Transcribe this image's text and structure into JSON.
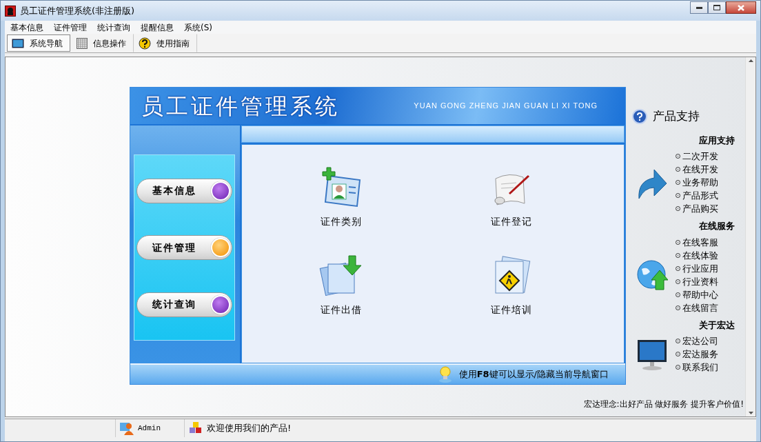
{
  "window": {
    "title": "员工证件管理系统(非注册版)"
  },
  "menu": [
    {
      "label": "基本信息"
    },
    {
      "label": "证件管理"
    },
    {
      "label": "统计查询"
    },
    {
      "label": "提醒信息"
    },
    {
      "label": "系统(S)"
    }
  ],
  "toolbar": [
    {
      "label": "系统导航",
      "selected": true,
      "kind": "window"
    },
    {
      "label": "信息操作",
      "selected": false,
      "kind": "grid"
    },
    {
      "label": "使用指南",
      "selected": false,
      "kind": "help"
    }
  ],
  "banner": {
    "title": "员工证件管理系统",
    "subtitle": "YUAN GONG ZHENG JIAN GUAN LI XI TONG"
  },
  "nav_buttons": [
    {
      "label": "基本信息",
      "selected": false
    },
    {
      "label": "证件管理",
      "selected": true
    },
    {
      "label": "统计查询",
      "selected": false
    }
  ],
  "tiles": [
    {
      "label": "证件类别",
      "kind": "card"
    },
    {
      "label": "证件登记",
      "kind": "scroll"
    },
    {
      "label": "证件出借",
      "kind": "download"
    },
    {
      "label": "证件培训",
      "kind": "sign"
    }
  ],
  "hint": "使用**F8**键可以显示/隐藏当前导航窗口",
  "support": {
    "title": "产品支持",
    "sections": [
      {
        "heading": "应用支持",
        "kind": "arrow",
        "links": [
          "二次开发",
          "在线开发",
          "业务帮助",
          "产品形式",
          "产品购买"
        ]
      },
      {
        "heading": "在线服务",
        "kind": "globe",
        "links": [
          "在线客服",
          "在线体验",
          "行业应用",
          "行业资料",
          "帮助中心",
          "在线留言"
        ]
      },
      {
        "heading": "关于宏达",
        "kind": "monitor",
        "links": [
          "宏达公司",
          "宏达服务",
          "联系我们"
        ]
      }
    ]
  },
  "slogan": "宏达理念:出好产品 做好服务 提升客户价值!",
  "status_bar": {
    "user": "Admin",
    "message": "欢迎使用我们的产品!"
  }
}
